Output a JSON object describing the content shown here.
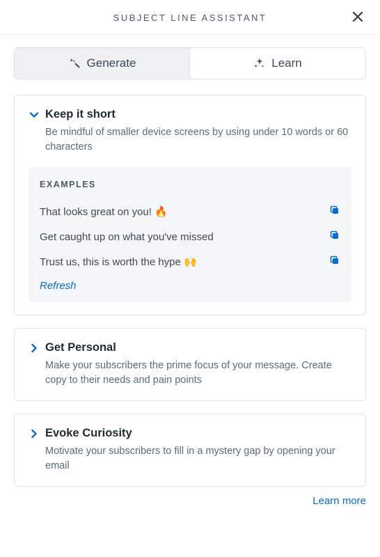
{
  "header": {
    "title": "SUBJECT LINE ASSISTANT"
  },
  "tabs": {
    "generate": "Generate",
    "learn": "Learn"
  },
  "cards": [
    {
      "title": "Keep it short",
      "desc": "Be mindful of smaller device screens by using under 10 words or 60 characters",
      "expanded": true,
      "examples_label": "EXAMPLES",
      "examples": [
        "That looks great on you! 🔥",
        "Get caught up on what you've missed",
        "Trust us, this is worth the hype 🙌"
      ],
      "refresh": "Refresh"
    },
    {
      "title": "Get Personal",
      "desc": "Make your subscribers the prime focus of your message. Create copy to their needs and pain points",
      "expanded": false
    },
    {
      "title": "Evoke Curiosity",
      "desc": "Motivate your subscribers to fill in a mystery gap by opening your email",
      "expanded": false
    }
  ],
  "footer": {
    "learn_more": "Learn more"
  }
}
